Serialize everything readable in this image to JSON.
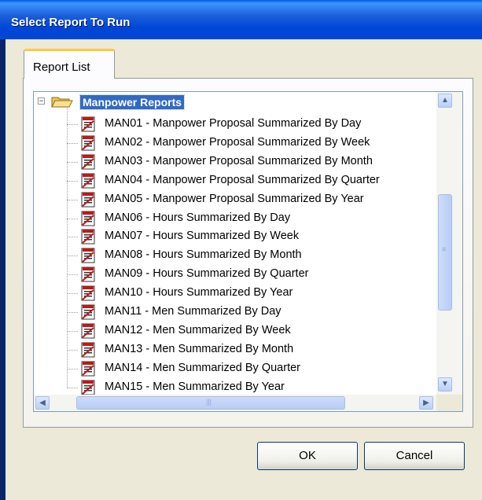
{
  "window": {
    "title": "Select Report To Run"
  },
  "tabs": [
    {
      "label": "Report List"
    }
  ],
  "tree": {
    "root": {
      "label": "Manpower Reports",
      "expander": "−"
    },
    "items": [
      "MAN01 - Manpower Proposal Summarized By Day",
      "MAN02 - Manpower Proposal Summarized By Week",
      "MAN03 - Manpower Proposal Summarized By Month",
      "MAN04 - Manpower Proposal Summarized By Quarter",
      "MAN05 - Manpower Proposal Summarized By Year",
      "MAN06 - Hours Summarized By Day",
      "MAN07 - Hours Summarized By Week",
      "MAN08 - Hours Summarized By Month",
      "MAN09 - Hours Summarized By Quarter",
      "MAN10 - Hours Summarized By Year",
      "MAN11 - Men Summarized By Day",
      "MAN12 - Men Summarized By Week",
      "MAN13 - Men Summarized By Month",
      "MAN14 - Men Summarized By Quarter",
      "MAN15 - Men Summarized By Year"
    ],
    "item_icon": "report-icon",
    "root_icon": "folder-open-icon"
  },
  "buttons": {
    "ok": "OK",
    "cancel": "Cancel"
  },
  "colors": {
    "titlebar": "#0046d6",
    "selection": "#316ac5",
    "dialog_bg": "#ece9d8"
  }
}
